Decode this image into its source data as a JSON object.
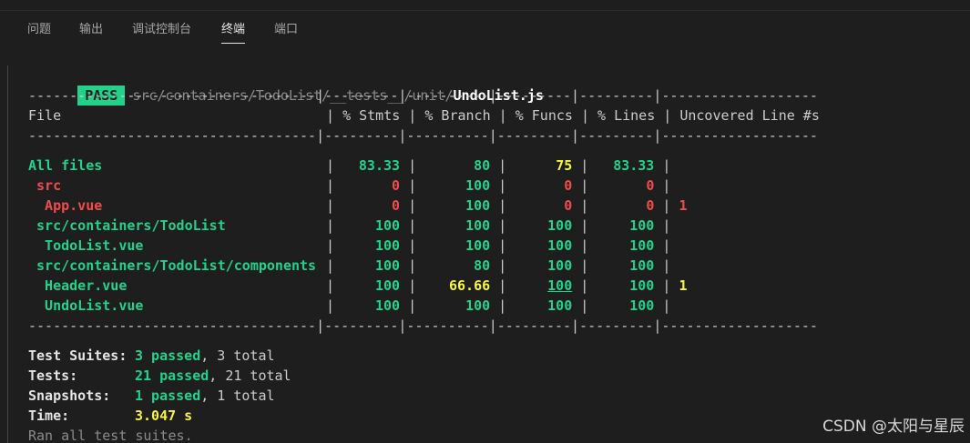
{
  "tabs": [
    {
      "label": "问题"
    },
    {
      "label": "输出"
    },
    {
      "label": "调试控制台"
    },
    {
      "label": "终端"
    },
    {
      "label": "端口"
    }
  ],
  "terminal": {
    "pass_badge": "PASS",
    "file_path_dim": "src/containers/TodoList/__tests__/unit/",
    "file_name": "UndoList.js",
    "divider": "-----------------------------------|---------|----------|---------|---------|-------------------",
    "headers": {
      "file": "File",
      "stmts": "% Stmts",
      "branch": "% Branch",
      "funcs": "% Funcs",
      "lines": "% Lines",
      "uncovered": "Uncovered Line #s"
    },
    "rows": [
      {
        "file": "All files",
        "stmts": "83.33",
        "branch": "80",
        "funcs": "75",
        "lines": "83.33",
        "uncovered": ""
      },
      {
        "file": " src",
        "stmts": "0",
        "branch": "100",
        "funcs": "0",
        "lines": "0",
        "uncovered": ""
      },
      {
        "file": "  App.vue",
        "stmts": "0",
        "branch": "100",
        "funcs": "0",
        "lines": "0",
        "uncovered": "1"
      },
      {
        "file": " src/containers/TodoList",
        "stmts": "100",
        "branch": "100",
        "funcs": "100",
        "lines": "100",
        "uncovered": ""
      },
      {
        "file": "  TodoList.vue",
        "stmts": "100",
        "branch": "100",
        "funcs": "100",
        "lines": "100",
        "uncovered": ""
      },
      {
        "file": " src/containers/TodoList/components",
        "stmts": "100",
        "branch": "80",
        "funcs": "100",
        "lines": "100",
        "uncovered": ""
      },
      {
        "file": "  Header.vue",
        "stmts": "100",
        "branch": "66.66",
        "funcs": "100",
        "lines": "100",
        "uncovered": "1"
      },
      {
        "file": "  UndoList.vue",
        "stmts": "100",
        "branch": "100",
        "funcs": "100",
        "lines": "100",
        "uncovered": ""
      }
    ],
    "summary": {
      "suites_label": "Test Suites:",
      "suites_passed": "3 passed",
      "suites_total": ", 3 total",
      "tests_label": "Tests:",
      "tests_passed": "21 passed",
      "tests_total": ", 21 total",
      "snapshots_label": "Snapshots:",
      "snapshots_passed": "1 passed",
      "snapshots_total": ", 1 total",
      "time_label": "Time:",
      "time_value": "3.047 s",
      "footer": "Ran all test suites."
    }
  },
  "watermark": "CSDN @太阳与星辰",
  "colors": {
    "background": "#1e1e1e",
    "green": "#23d18b",
    "red": "#f14c4c",
    "yellow": "#f5f543"
  }
}
